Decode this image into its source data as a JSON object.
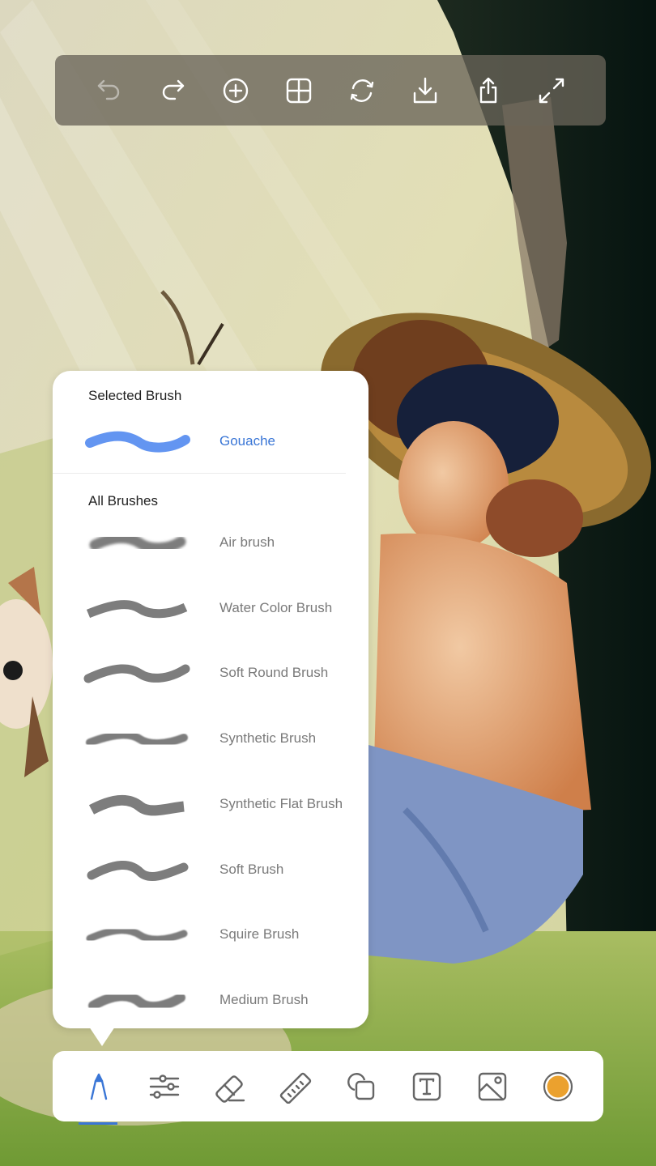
{
  "top_toolbar": {
    "buttons": [
      {
        "id": "undo",
        "icon": "undo-icon",
        "label": "Undo",
        "enabled": false
      },
      {
        "id": "redo",
        "icon": "redo-icon",
        "label": "Redo",
        "enabled": true
      },
      {
        "id": "add",
        "icon": "plus-circle-icon",
        "label": "Add",
        "enabled": true
      },
      {
        "id": "grid",
        "icon": "grid-icon",
        "label": "Layers",
        "enabled": true
      },
      {
        "id": "sync",
        "icon": "refresh-icon",
        "label": "Sync",
        "enabled": true
      },
      {
        "id": "download",
        "icon": "download-icon",
        "label": "Download",
        "enabled": true
      },
      {
        "id": "share",
        "icon": "share-icon",
        "label": "Share",
        "enabled": true
      },
      {
        "id": "fullscreen",
        "icon": "expand-icon",
        "label": "Fullscreen",
        "enabled": true
      }
    ]
  },
  "brush_panel": {
    "selected_title": "Selected Brush",
    "selected_brush": {
      "name": "Gouache",
      "color": "#5b8ff0"
    },
    "all_title": "All Brushes",
    "brushes": [
      {
        "name": "Air brush",
        "style": "air"
      },
      {
        "name": "Water Color Brush",
        "style": "watercolor"
      },
      {
        "name": "Soft Round Brush",
        "style": "round"
      },
      {
        "name": "Synthetic Brush",
        "style": "synthetic"
      },
      {
        "name": "Synthetic Flat Brush",
        "style": "flat"
      },
      {
        "name": "Soft Brush",
        "style": "soft"
      },
      {
        "name": "Squire Brush",
        "style": "squire"
      },
      {
        "name": "Medium Brush",
        "style": "medium"
      }
    ],
    "stroke_color": "#7d7d7d"
  },
  "bottom_toolbar": {
    "active_tool": "brush",
    "accent_color": "#3a76d6",
    "current_color": "#eba12e",
    "tools": [
      {
        "id": "brush",
        "icon": "brush-icon",
        "label": "Brush"
      },
      {
        "id": "adjust",
        "icon": "sliders-icon",
        "label": "Adjust"
      },
      {
        "id": "eraser",
        "icon": "eraser-icon",
        "label": "Eraser"
      },
      {
        "id": "ruler",
        "icon": "ruler-icon",
        "label": "Ruler"
      },
      {
        "id": "shapes",
        "icon": "shapes-icon",
        "label": "Shapes"
      },
      {
        "id": "text",
        "icon": "text-icon",
        "label": "Text"
      },
      {
        "id": "image",
        "icon": "image-icon",
        "label": "Image"
      },
      {
        "id": "color",
        "icon": "color-swatch-icon",
        "label": "Color"
      }
    ]
  }
}
